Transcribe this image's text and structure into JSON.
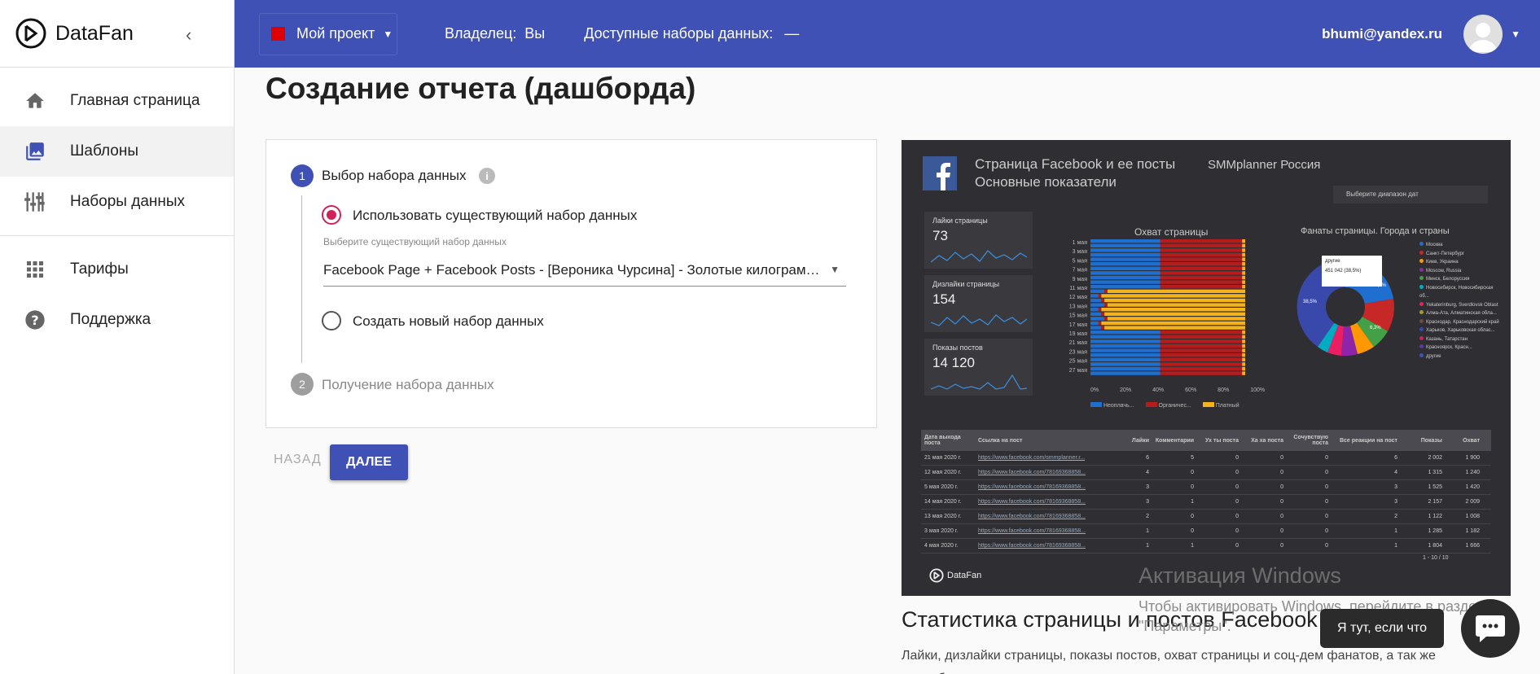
{
  "app": {
    "name": "DataFan"
  },
  "sidebar": {
    "items": [
      {
        "label": "Главная страница",
        "icon": "home-icon"
      },
      {
        "label": "Шаблоны",
        "icon": "image-icon",
        "active": true
      },
      {
        "label": "Наборы данных",
        "icon": "dataset-icon"
      },
      {
        "label": "Тарифы",
        "icon": "grid-icon"
      },
      {
        "label": "Поддержка",
        "icon": "help-icon"
      }
    ]
  },
  "topbar": {
    "project": "Мой проект",
    "owner_label": "Владелец:",
    "owner_value": "Вы",
    "datasets_label": "Доступные наборы данных:",
    "datasets_value": "—",
    "email": "bhumi@yandex.ru"
  },
  "page": {
    "title": "Создание отчета (дашборда)"
  },
  "wizard": {
    "step1": {
      "num": "1",
      "label": "Выбор набора данных"
    },
    "step2": {
      "num": "2",
      "label": "Получение набора данных"
    },
    "option_existing": "Использовать существующий набор данных",
    "hint": "Выберите существующий набор данных",
    "selected_dataset": "Facebook Page + Facebook Posts - [Вероника Чурсина] - Золотые килограммы",
    "option_new": "Создать новый набор данных",
    "back": "НАЗАД",
    "next": "ДАЛЕЕ"
  },
  "preview": {
    "header_title": "Страница Facebook и ее посты",
    "header_sub": "Основные показатели",
    "brand": "SMMplanner Россия",
    "date_range": "Выберите диапазон дат",
    "kpis": [
      {
        "label": "Лайки страницы",
        "value": "73"
      },
      {
        "label": "Дизлайки страницы",
        "value": "154"
      },
      {
        "label": "Показы постов",
        "value": "14 120"
      }
    ],
    "reach_title": "Охват страницы",
    "fans_title": "Фанаты страницы. Города и страны",
    "reach_legend": [
      "Неоплачь...",
      "Органичес...",
      "Платный"
    ],
    "fans_tooltip_label": "другие",
    "fans_tooltip_value": "451 042 (38,5%)",
    "fans_legend": [
      "Москва",
      "Санкт-Петербург",
      "Киев, Украина",
      "Moscow, Russia",
      "Минск, Белоруссия",
      "Новосибирск, Новосибирская об...",
      "Yekaterinburg, Sverdlovsk Oblast",
      "Алма-Ата, Алматинская обла...",
      "Краснодар, Краснодарский край",
      "Харьков, Харьковская облас...",
      "Казань, Татарстан",
      "Красноярск, Красн...",
      "другие"
    ],
    "fans_labels": [
      "34,9%",
      "38,5%",
      "6,3%"
    ],
    "table_headers": [
      "Дата выхода поста",
      "Ссылка на пост",
      "Лайки",
      "Комментарии",
      "Ух ты поста",
      "Ха ха поста",
      "Сочувствую поста",
      "Все реакции на пост",
      "Показы",
      "Охват"
    ],
    "table_rows": [
      [
        "21 мая 2020 г.",
        "https://www.facebook.com/smmplanner.r...",
        "6",
        "5",
        "0",
        "0",
        "0",
        "6",
        "2 002",
        "1 900"
      ],
      [
        "12 мая 2020 г.",
        "https://www.facebook.com/78169368858...",
        "4",
        "0",
        "0",
        "0",
        "0",
        "4",
        "1 315",
        "1 240"
      ],
      [
        "5 мая 2020 г.",
        "https://www.facebook.com/78169368858...",
        "3",
        "0",
        "0",
        "0",
        "0",
        "3",
        "1 525",
        "1 420"
      ],
      [
        "14 мая 2020 г.",
        "https://www.facebook.com/78169368858...",
        "3",
        "1",
        "0",
        "0",
        "0",
        "3",
        "2 157",
        "2 009"
      ],
      [
        "13 мая 2020 г.",
        "https://www.facebook.com/78169368858...",
        "2",
        "0",
        "0",
        "0",
        "0",
        "2",
        "1 122",
        "1 008"
      ],
      [
        "3 мая 2020 г.",
        "https://www.facebook.com/78169368858...",
        "1",
        "0",
        "0",
        "0",
        "0",
        "1",
        "1 285",
        "1 182"
      ],
      [
        "4 мая 2020 г.",
        "https://www.facebook.com/78169368858...",
        "1",
        "1",
        "0",
        "0",
        "0",
        "1",
        "1 804",
        "1 666"
      ]
    ],
    "pager": "1 - 10 / 10",
    "footer_logo": "DataFan",
    "title": "Статистика страницы и постов Facebook",
    "desc": "Лайки, дизлайки страницы, показы постов, охват страницы и соц-дем фанатов, а так же подробная статистика постов"
  },
  "windows_activation": {
    "title": "Активация Windows",
    "text": "Чтобы активировать Windows, перейдите в раздел \"Параметры\"."
  },
  "chat": {
    "tip": "Я тут, если что"
  }
}
